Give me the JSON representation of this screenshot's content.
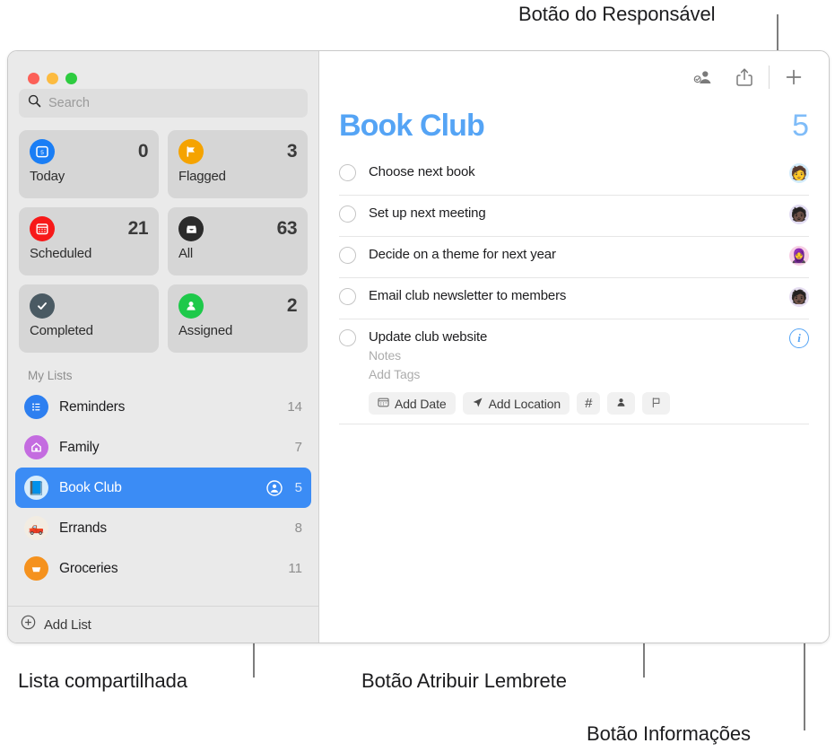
{
  "callouts": [
    {
      "id": "assignee-button",
      "text": "Botão do Responsável"
    },
    {
      "id": "shared-list",
      "text": "Lista compartilhada"
    },
    {
      "id": "assign-reminder",
      "text": "Botão Atribuir Lembrete"
    },
    {
      "id": "info-button",
      "text": "Botão Informações"
    }
  ],
  "window": {
    "traffic_lights": [
      "close",
      "minimize",
      "zoom"
    ]
  },
  "sidebar": {
    "search": {
      "placeholder": "Search",
      "value": "",
      "icon": "search-icon"
    },
    "smart_lists": [
      {
        "label": "Today",
        "count": "0",
        "icon": "calendar-day-icon",
        "color": "#1a7ef5"
      },
      {
        "label": "Flagged",
        "count": "3",
        "icon": "flag-icon",
        "color": "#f5a300"
      },
      {
        "label": "Scheduled",
        "count": "21",
        "icon": "calendar-icon",
        "color": "#f71919"
      },
      {
        "label": "All",
        "count": "63",
        "icon": "inbox-icon",
        "color": "#2b2b2b"
      },
      {
        "label": "Completed",
        "count": "",
        "icon": "checkmark-icon",
        "color": "#4a5a63"
      },
      {
        "label": "Assigned",
        "count": "2",
        "icon": "person-icon",
        "color": "#1ec94a"
      }
    ],
    "my_lists_header": "My Lists",
    "lists": [
      {
        "name": "Reminders",
        "count": "14",
        "icon": "bullet-list-icon",
        "color": "#2d7ff0",
        "glyph": "☰",
        "shared": false,
        "selected": false
      },
      {
        "name": "Family",
        "count": "7",
        "icon": "house-icon",
        "color": "#c46ce0",
        "glyph": "⌂",
        "shared": false,
        "selected": false
      },
      {
        "name": "Book Club",
        "count": "5",
        "icon": "book-icon",
        "color": "#d7ecfb",
        "glyph": "📘",
        "shared": true,
        "selected": true
      },
      {
        "name": "Errands",
        "count": "8",
        "icon": "truck-icon",
        "color": "#f2ece2",
        "glyph": "🛻",
        "shared": false,
        "selected": false
      },
      {
        "name": "Groceries",
        "count": "11",
        "icon": "basket-icon",
        "color": "#f5921e",
        "glyph": "🧺",
        "shared": false,
        "selected": false
      }
    ],
    "add_list": {
      "label": "Add List",
      "icon": "plus-circle-icon"
    }
  },
  "main": {
    "toolbar": [
      {
        "id": "assignee-button",
        "icon": "person-check-icon"
      },
      {
        "id": "share-button",
        "icon": "share-icon"
      },
      {
        "id": "add-button",
        "icon": "plus-icon"
      }
    ],
    "title": "Book Club",
    "count": "5",
    "reminders": [
      {
        "title": "Choose next book",
        "avatar": "🧑",
        "avatar_bg": "#d3ecfb",
        "expanded": false
      },
      {
        "title": "Set up next meeting",
        "avatar": "🧑🏿",
        "avatar_bg": "#e2dcf2",
        "expanded": false
      },
      {
        "title": "Decide on a theme for next year",
        "avatar": "🧕",
        "avatar_bg": "#f7cfe4",
        "expanded": false
      },
      {
        "title": "Email club newsletter to members",
        "avatar": "🧑🏿",
        "avatar_bg": "#e7dff2",
        "expanded": false
      },
      {
        "title": "Update club website",
        "avatar": "",
        "avatar_bg": "",
        "expanded": true,
        "notes_placeholder": "Notes",
        "tags_placeholder": "Add Tags",
        "chips": [
          {
            "id": "add-date-chip",
            "label": "Add Date",
            "icon": "calendar-icon"
          },
          {
            "id": "add-location-chip",
            "label": "Add Location",
            "icon": "location-arrow-icon"
          },
          {
            "id": "add-tag-chip",
            "label": "#",
            "icon": "hash-icon"
          },
          {
            "id": "assign-chip",
            "label": "",
            "icon": "person-icon"
          },
          {
            "id": "flag-chip",
            "label": "",
            "icon": "flag-outline-icon"
          }
        ],
        "info_button": {
          "id": "info-button",
          "icon": "info-circle-icon",
          "glyph": "i"
        }
      }
    ]
  }
}
